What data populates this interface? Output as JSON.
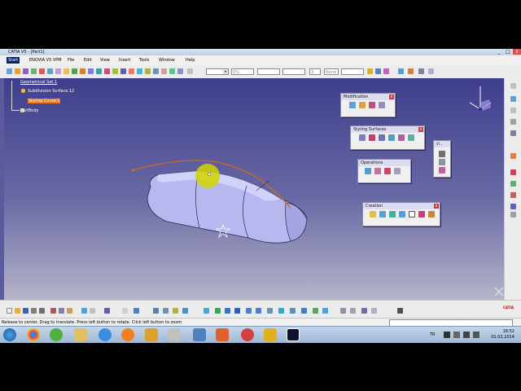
{
  "window": {
    "title": "CATIA V5 - [Part1]",
    "controls": [
      "_",
      "□",
      "x"
    ]
  },
  "menu": {
    "items": [
      "Start",
      "ENOVIA V5 VPM",
      "File",
      "Edit",
      "View",
      "Insert",
      "Tools",
      "Window",
      "Help"
    ]
  },
  "toolbar": {
    "color_combo": "",
    "transparency_combo": "0%",
    "linetype_combo": "",
    "thickness_combo": "",
    "point_combo": "3",
    "layer_combo": "None"
  },
  "tree": {
    "geometrical_set": "Geometrical Set.1",
    "subdivision_surface": "Subdivision Surface.12",
    "styling_curve": "Styling Curve.1",
    "part_body": "PartBody"
  },
  "panels": {
    "modification": "Modification",
    "styling_surfaces": "Styling Surfaces",
    "vi": "Vi...",
    "operations": "Operations",
    "creation": "Creation"
  },
  "status": {
    "message": "Release to center. Drag to translate. Press left button to rotate. Click left button to zoom"
  },
  "taskbar": {
    "lang": "TR",
    "time": "18:52",
    "date": "01.02.2014"
  },
  "colors": {
    "viewport_top": "#3e3e8c",
    "viewport_bottom": "#b5b5c9",
    "styling_curve": "#d2691e",
    "selected_highlight": "#f07818",
    "manipulator": "#d4d400"
  }
}
